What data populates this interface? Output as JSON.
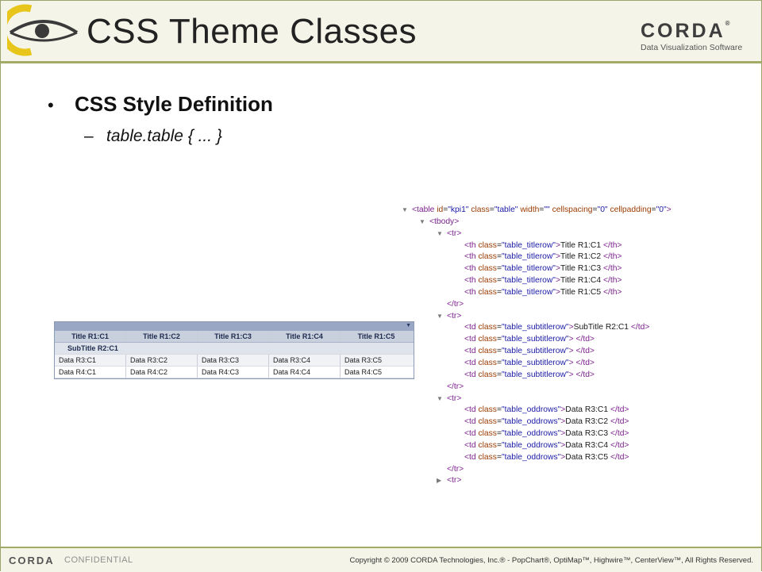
{
  "header": {
    "title": "CSS Theme Classes",
    "brand_name": "CORDA",
    "brand_reg": "®",
    "brand_sub": "Data Visualization Software"
  },
  "body": {
    "bullet": "CSS Style Definition",
    "sub_bullet": "table.table { ... }"
  },
  "code_lines": [
    {
      "indent": 0,
      "tri": "down",
      "html": "<table id=\"kpi1\" class=\"table\" width=\"\" cellspacing=\"0\" cellpadding=\"0\">"
    },
    {
      "indent": 1,
      "tri": "down",
      "html": "<tbody>"
    },
    {
      "indent": 2,
      "tri": "down",
      "html": "<tr>"
    },
    {
      "indent": 3,
      "tri": "",
      "html": "<th class=\"table_titlerow\">Title R1:C1 </th>"
    },
    {
      "indent": 3,
      "tri": "",
      "html": "<th class=\"table_titlerow\">Title R1:C2 </th>"
    },
    {
      "indent": 3,
      "tri": "",
      "html": "<th class=\"table_titlerow\">Title R1:C3 </th>"
    },
    {
      "indent": 3,
      "tri": "",
      "html": "<th class=\"table_titlerow\">Title R1:C4 </th>"
    },
    {
      "indent": 3,
      "tri": "",
      "html": "<th class=\"table_titlerow\">Title R1:C5 </th>"
    },
    {
      "indent": 2,
      "tri": "",
      "html": "</tr>"
    },
    {
      "indent": 2,
      "tri": "down",
      "html": "<tr>"
    },
    {
      "indent": 3,
      "tri": "",
      "html": "<td class=\"table_subtitlerow\">SubTitle R2:C1 </td>"
    },
    {
      "indent": 3,
      "tri": "",
      "html": "<td class=\"table_subtitlerow\"> </td>"
    },
    {
      "indent": 3,
      "tri": "",
      "html": "<td class=\"table_subtitlerow\"> </td>"
    },
    {
      "indent": 3,
      "tri": "",
      "html": "<td class=\"table_subtitlerow\"> </td>"
    },
    {
      "indent": 3,
      "tri": "",
      "html": "<td class=\"table_subtitlerow\"> </td>"
    },
    {
      "indent": 2,
      "tri": "",
      "html": "</tr>"
    },
    {
      "indent": 2,
      "tri": "down",
      "html": "<tr>"
    },
    {
      "indent": 3,
      "tri": "",
      "html": "<td class=\"table_oddrows\">Data R3:C1 </td>"
    },
    {
      "indent": 3,
      "tri": "",
      "html": "<td class=\"table_oddrows\">Data R3:C2 </td>"
    },
    {
      "indent": 3,
      "tri": "",
      "html": "<td class=\"table_oddrows\">Data R3:C3 </td>"
    },
    {
      "indent": 3,
      "tri": "",
      "html": "<td class=\"table_oddrows\">Data R3:C4 </td>"
    },
    {
      "indent": 3,
      "tri": "",
      "html": "<td class=\"table_oddrows\">Data R3:C5 </td>"
    },
    {
      "indent": 2,
      "tri": "",
      "html": "</tr>"
    },
    {
      "indent": 2,
      "tri": "right",
      "html": "<tr>"
    }
  ],
  "rendered_table": {
    "title_row": [
      "Title R1:C1",
      "Title R1:C2",
      "Title R1:C3",
      "Title R1:C4",
      "Title R1:C5"
    ],
    "subtitle": "SubTitle R2:C1",
    "rows": [
      [
        "Data R3:C1",
        "Data R3:C2",
        "Data R3:C3",
        "Data R3:C4",
        "Data R3:C5"
      ],
      [
        "Data R4:C1",
        "Data R4:C2",
        "Data R4:C3",
        "Data R4:C4",
        "Data R4:C5"
      ]
    ]
  },
  "footer": {
    "brand": "CORDA",
    "confidential": "CONFIDENTIAL",
    "copyright": "Copyright © 2009 CORDA Technologies, Inc.® - PopChart®, OptiMap™, Highwire™, CenterView™, All Rights Reserved."
  },
  "colors": {
    "accent": "#a3ab66",
    "header_bg": "#f4f5e8",
    "logo_yellow": "#e8c51a",
    "table_header": "#c8cfdd"
  }
}
